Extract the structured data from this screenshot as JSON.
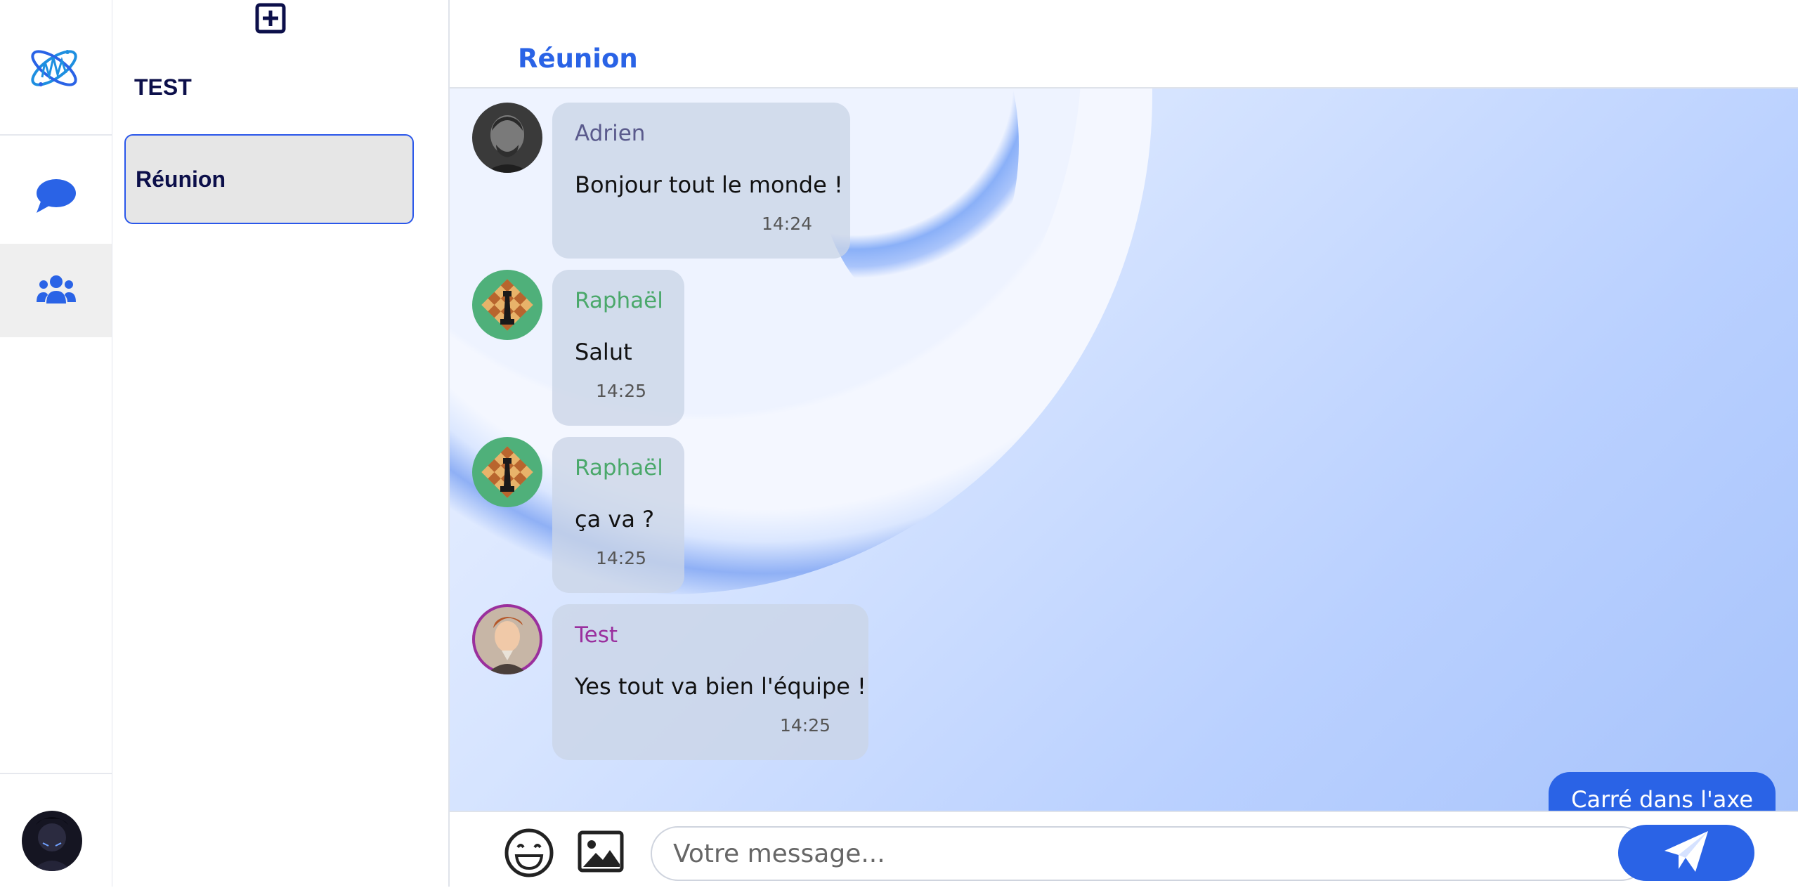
{
  "sidebar": {
    "logo_icon": "atom-logo-icon",
    "nav": [
      {
        "id": "chat",
        "icon": "chat-bubble-icon"
      },
      {
        "id": "groups",
        "icon": "users-icon",
        "active": true
      }
    ],
    "accent": "#2a63e6"
  },
  "group_panel": {
    "add_icon": "plus-square-icon",
    "section_title": "TEST",
    "items": [
      {
        "label": "Réunion",
        "selected": true
      }
    ]
  },
  "chat": {
    "title": "Réunion",
    "messages": [
      {
        "author": "Adrien",
        "author_color": "#5a5a8c",
        "text": "Bonjour tout le monde !",
        "time": "14:24"
      },
      {
        "author": "Raphaël",
        "author_color": "#4aa86a",
        "text": "Salut",
        "time": "14:25"
      },
      {
        "author": "Raphaël",
        "author_color": "#4aa86a",
        "text": "ça va ?",
        "time": "14:25"
      },
      {
        "author": "Test",
        "author_color": "#9a2f9e",
        "text": "Yes tout va bien l'équipe !",
        "time": "14:25"
      }
    ],
    "own_message_partial": "Carré dans l'axe"
  },
  "composer": {
    "placeholder": "Votre message...",
    "emoji_icon": "smile-icon",
    "image_icon": "image-icon",
    "send_icon": "paper-plane-icon"
  }
}
